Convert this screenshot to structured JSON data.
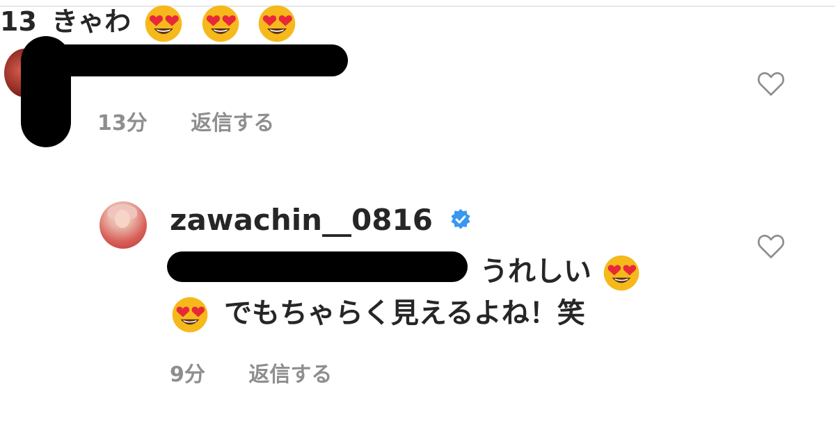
{
  "comments": [
    {
      "username_suffix": "13",
      "text": "きゃわ",
      "emojis": [
        "heart-eyes",
        "heart-eyes",
        "heart-eyes"
      ],
      "time": "13分",
      "reply_label": "返信する",
      "like_icon": "heart-outline-icon"
    },
    {
      "username": "zawachin__0816",
      "verified_icon": "verified-badge-icon",
      "text_line1": "うれしい",
      "text_line2": "でもちゃらく見えるよね！笑",
      "time": "9分",
      "reply_label": "返信する",
      "like_icon": "heart-outline-icon"
    }
  ],
  "colors": {
    "text": "#262626",
    "meta": "#8e8e8e",
    "verified": "#3897f0",
    "redaction": "#000000"
  }
}
